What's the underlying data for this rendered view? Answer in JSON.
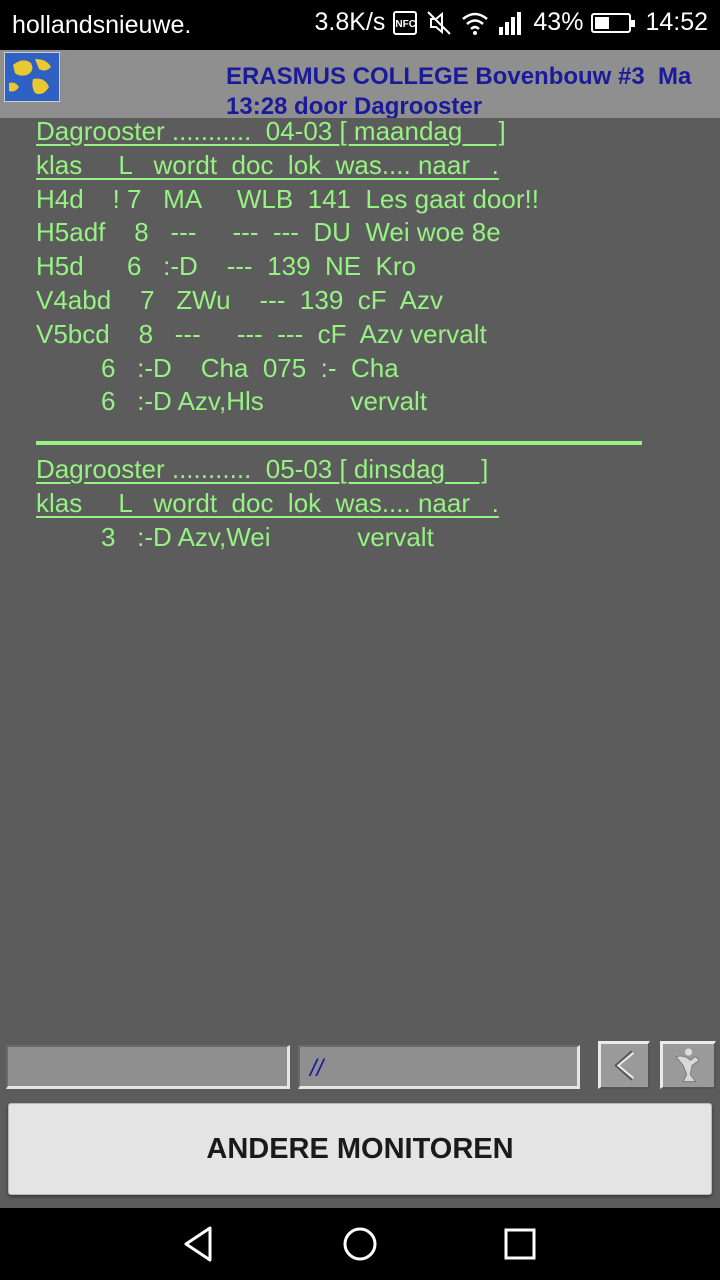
{
  "status_bar": {
    "carrier": "hollandsnieuwe.",
    "speed": "3.8K/s",
    "nfc_label": "NFC",
    "battery_percent": "43%",
    "battery_level": 0.43,
    "time": "14:52"
  },
  "header": {
    "title": "ERASMUS COLLEGE Bovenbouw #3  Ma\n13:28 door Dagrooster"
  },
  "schedule": {
    "lines": [
      "Dagrooster ...........  04-03 [ maandag     ]",
      "klas     L   wordt  doc  lok  was.... naar   .",
      "H4d    ! 7   MA     WLB  141  Les gaat door!!",
      "H5adf    8   ---     ---  ---  DU  Wei woe 8e",
      "H5d      6   :-D    ---  139  NE  Kro",
      "V4abd    7   ZWu    ---  139  cF  Azv",
      "V5bcd    8   ---     ---  ---  cF  Azv vervalt",
      "         6   :-D    Cha  075  :-  Cha",
      "         6   :-D Azv,Hls            vervalt",
      "Dagrooster ...........  05-03 [ dinsdag     ]",
      "klas     L   wordt  doc  lok  was.... naar   .",
      "         3   :-D Azv,Wei            vervalt"
    ]
  },
  "toolbar": {
    "field_left_value": "",
    "field_right_value": "//"
  },
  "buttons": {
    "andere_monitoren": "ANDERE MONITOREN"
  },
  "colors": {
    "text_green": "#97f284",
    "title_blue": "#1b1b9a",
    "background": "#5c5c5c"
  }
}
